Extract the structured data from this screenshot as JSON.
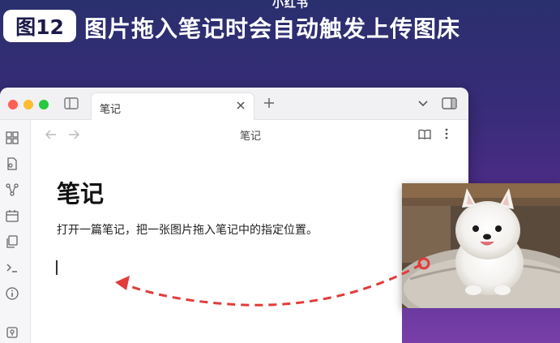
{
  "banner": {
    "top_fragment": "小红书",
    "figure_label": "图12",
    "headline": "图片拖入笔记时会自动触发上传图床"
  },
  "window": {
    "tab_label": "笔记",
    "view_title": "笔记"
  },
  "note": {
    "title": "笔记",
    "paragraph": "打开一篇笔记，把一张图片拖入笔记中的指定位置。"
  },
  "colors": {
    "traffic_red": "#ff5f57",
    "traffic_yellow": "#febc2e",
    "traffic_green": "#28c840",
    "drag_arrow": "#e23b3b",
    "background_gradient_top": "#2a2f6e",
    "background_gradient_bottom": "#7a3aa6"
  },
  "icons": {
    "titlebar": [
      "sidebar-toggle-icon",
      "close-icon",
      "plus-icon",
      "chevron-down-icon",
      "right-panel-icon"
    ],
    "ribbon": [
      "quick-switcher-icon",
      "file-icon",
      "graph-icon",
      "calendar-icon",
      "copy-icon",
      "terminal-icon",
      "help-icon",
      "vault-icon"
    ],
    "header": [
      "arrow-left-icon",
      "arrow-right-icon",
      "book-open-icon",
      "more-vertical-icon"
    ]
  }
}
